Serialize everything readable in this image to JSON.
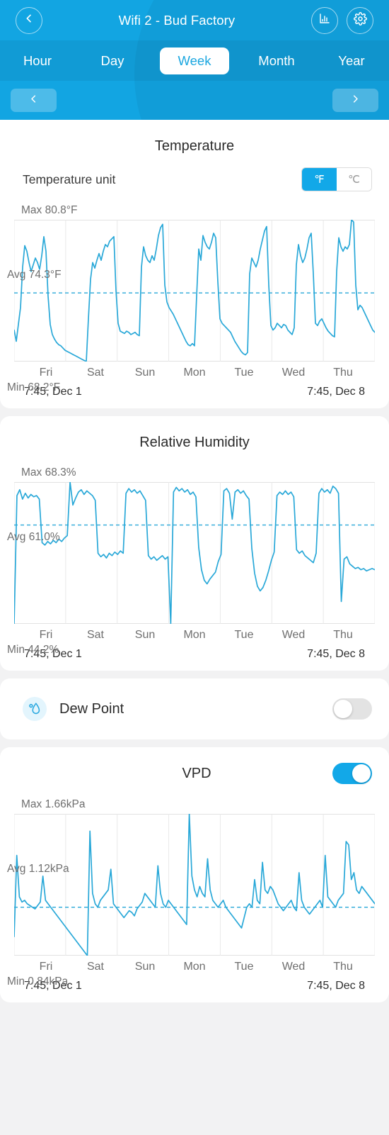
{
  "header": {
    "title": "Wifi 2 - Bud Factory",
    "back_icon": "chevron-left-icon",
    "stats_icon": "bar-chart-icon",
    "settings_icon": "gear-icon",
    "accent": "#12a5e2",
    "tabs": [
      {
        "label": "Hour",
        "active": false
      },
      {
        "label": "Day",
        "active": false
      },
      {
        "label": "Week",
        "active": true
      },
      {
        "label": "Month",
        "active": false
      },
      {
        "label": "Year",
        "active": false
      }
    ],
    "nav": {
      "prev_icon": "chevron-left-icon",
      "next_icon": "chevron-right-icon"
    }
  },
  "temperature": {
    "title": "Temperature",
    "unit_label": "Temperature unit",
    "unit_options": [
      {
        "label": "℉",
        "active": true
      },
      {
        "label": "℃",
        "active": false
      }
    ],
    "max_label": "Max 80.8°F",
    "avg_label": "Avg 74.3°F",
    "min_label": "Min 68.2°F",
    "range_start": "7:45,  Dec 1",
    "range_end": "7:45,  Dec 8"
  },
  "humidity": {
    "title": "Relative Humidity",
    "max_label": "Max 68.3%",
    "avg_label": "Avg 61.0%",
    "min_label": "Min 44.2%",
    "range_start": "7:45,  Dec 1",
    "range_end": "7:45,  Dec 8"
  },
  "dew_point": {
    "label": "Dew Point",
    "icon": "dew-drop-icon",
    "toggle_on": false
  },
  "vpd": {
    "title": "VPD",
    "toggle_on": true,
    "max_label": "Max 1.66kPa",
    "avg_label": "Avg 1.12kPa",
    "min_label": "Min 0.84kPa",
    "range_start": "7:45,  Dec 1",
    "range_end": "7:45,  Dec 8"
  },
  "x_axis_days": [
    "Fri",
    "Sat",
    "Sun",
    "Mon",
    "Tue",
    "Wed",
    "Thu"
  ],
  "chart_data": [
    {
      "id": "temperature",
      "type": "line",
      "title": "Temperature",
      "ylabel": "°F",
      "xlabel": "",
      "unit": "°F",
      "grid": true,
      "legend": "none",
      "tick_labels": [
        "Fri",
        "Sat",
        "Sun",
        "Mon",
        "Tue",
        "Wed",
        "Thu"
      ],
      "x_start": "7:45, Dec 1",
      "x_end": "7:45, Dec 8",
      "max": 80.8,
      "avg": 74.3,
      "min": 68.2,
      "ylim": [
        68.2,
        80.8
      ],
      "line_color": "#29a8d8",
      "avg_line_style": "dashed",
      "values": [
        71.0,
        70.0,
        71.5,
        73.0,
        76.6,
        78.5,
        78.0,
        77.0,
        76.2,
        76.8,
        77.4,
        77.0,
        76.4,
        77.6,
        79.3,
        78.0,
        74.0,
        71.5,
        70.6,
        70.2,
        69.9,
        69.7,
        69.6,
        69.4,
        69.2,
        69.1,
        69.0,
        68.9,
        68.8,
        68.7,
        68.6,
        68.5,
        68.4,
        68.3,
        68.2,
        72.0,
        75.5,
        77.0,
        76.5,
        77.2,
        77.8,
        77.2,
        78.0,
        78.6,
        78.4,
        78.9,
        79.1,
        79.3,
        74.5,
        71.6,
        70.9,
        70.8,
        70.7,
        70.9,
        70.8,
        70.6,
        70.7,
        70.8,
        70.6,
        70.5,
        76.6,
        78.4,
        77.6,
        77.2,
        77.0,
        77.6,
        77.2,
        78.2,
        79.4,
        80.1,
        80.4,
        75.0,
        73.5,
        73.0,
        72.7,
        72.4,
        72.0,
        71.6,
        71.2,
        70.8,
        70.4,
        70.0,
        69.7,
        69.6,
        69.8,
        69.6,
        74.0,
        78.2,
        77.2,
        79.4,
        78.8,
        78.4,
        78.2,
        78.8,
        79.6,
        79.2,
        75.3,
        72.0,
        71.6,
        71.4,
        71.2,
        71.0,
        70.8,
        70.4,
        70.0,
        69.7,
        69.4,
        69.1,
        68.9,
        68.8,
        69.0,
        76.0,
        77.4,
        77.0,
        76.6,
        77.2,
        78.2,
        79.0,
        79.8,
        80.2,
        75.0,
        71.4,
        71.0,
        71.2,
        71.6,
        71.4,
        71.2,
        71.5,
        71.4,
        71.0,
        70.8,
        70.6,
        71.2,
        76.8,
        78.6,
        77.6,
        77.0,
        77.4,
        78.2,
        79.2,
        79.6,
        76.0,
        71.6,
        71.4,
        71.8,
        72.0,
        71.6,
        71.2,
        70.9,
        70.7,
        70.5,
        70.4,
        76.2,
        79.2,
        78.4,
        78.0,
        78.4,
        78.2,
        78.6,
        80.8,
        80.6,
        75.0,
        72.8,
        73.2,
        73.0,
        72.6,
        72.2,
        71.8,
        71.4,
        71.0,
        70.8
      ]
    },
    {
      "id": "humidity",
      "type": "line",
      "title": "Relative Humidity",
      "ylabel": "%",
      "xlabel": "",
      "unit": "%",
      "grid": true,
      "legend": "none",
      "tick_labels": [
        "Fri",
        "Sat",
        "Sun",
        "Mon",
        "Tue",
        "Wed",
        "Thu"
      ],
      "x_start": "7:45, Dec 1",
      "x_end": "7:45, Dec 8",
      "max": 68.3,
      "avg": 61.0,
      "min": 44.2,
      "ylim": [
        44.2,
        68.3
      ],
      "line_color": "#29a8d8",
      "avg_line_style": "dashed",
      "values": [
        44.2,
        66.0,
        67.0,
        65.4,
        66.4,
        65.6,
        66.2,
        65.8,
        66.0,
        65.4,
        58.0,
        57.6,
        58.2,
        57.8,
        58.4,
        58.0,
        58.6,
        58.2,
        58.8,
        59.2,
        68.3,
        64.4,
        65.6,
        66.6,
        67.0,
        66.2,
        66.8,
        66.4,
        66.0,
        65.2,
        56.2,
        55.6,
        56.0,
        55.4,
        56.2,
        55.8,
        56.4,
        56.0,
        56.6,
        56.2,
        66.4,
        67.2,
        66.6,
        67.0,
        66.4,
        66.8,
        66.0,
        65.2,
        55.8,
        55.2,
        55.6,
        55.0,
        55.4,
        55.8,
        55.2,
        55.6,
        44.2,
        66.6,
        67.4,
        66.8,
        67.2,
        66.6,
        67.0,
        66.2,
        66.6,
        65.8,
        57.2,
        53.4,
        51.6,
        51.0,
        51.8,
        52.4,
        53.0,
        54.8,
        56.0,
        66.8,
        67.2,
        66.4,
        62.0,
        66.6,
        67.0,
        66.4,
        66.8,
        66.0,
        65.4,
        57.0,
        52.8,
        50.6,
        49.8,
        50.4,
        51.6,
        53.2,
        55.0,
        56.4,
        66.0,
        66.6,
        66.2,
        66.8,
        66.2,
        66.6,
        65.8,
        56.8,
        56.2,
        56.6,
        55.8,
        55.4,
        55.0,
        54.6,
        56.2,
        66.4,
        67.2,
        66.6,
        67.0,
        66.4,
        67.6,
        67.2,
        66.4,
        48.0,
        55.2,
        55.6,
        54.4,
        54.0,
        53.6,
        53.8,
        53.4,
        53.6,
        53.2,
        53.4,
        53.6,
        53.4
      ]
    },
    {
      "id": "vpd",
      "type": "line",
      "title": "VPD",
      "ylabel": "kPa",
      "xlabel": "",
      "unit": "kPa",
      "grid": true,
      "legend": "none",
      "tick_labels": [
        "Fri",
        "Sat",
        "Sun",
        "Mon",
        "Tue",
        "Wed",
        "Thu"
      ],
      "x_start": "7:45, Dec 1",
      "x_end": "7:45, Dec 8",
      "max": 1.66,
      "avg": 1.12,
      "min": 0.84,
      "ylim": [
        0.84,
        1.66
      ],
      "line_color": "#29a8d8",
      "avg_line_style": "dashed",
      "values": [
        0.95,
        1.42,
        1.18,
        1.15,
        1.16,
        1.14,
        1.13,
        1.12,
        1.11,
        1.13,
        1.15,
        1.3,
        1.16,
        1.14,
        1.12,
        1.1,
        1.08,
        1.06,
        1.04,
        1.02,
        1.0,
        0.98,
        0.96,
        0.94,
        0.92,
        0.9,
        0.88,
        0.86,
        0.84,
        1.56,
        1.2,
        1.14,
        1.12,
        1.16,
        1.18,
        1.2,
        1.22,
        1.34,
        1.14,
        1.12,
        1.1,
        1.08,
        1.06,
        1.08,
        1.1,
        1.09,
        1.07,
        1.11,
        1.13,
        1.15,
        1.2,
        1.18,
        1.16,
        1.14,
        1.12,
        1.36,
        1.2,
        1.14,
        1.12,
        1.16,
        1.14,
        1.12,
        1.1,
        1.08,
        1.06,
        1.04,
        1.02,
        1.66,
        1.3,
        1.22,
        1.18,
        1.24,
        1.2,
        1.18,
        1.4,
        1.22,
        1.16,
        1.14,
        1.12,
        1.14,
        1.16,
        1.12,
        1.1,
        1.08,
        1.06,
        1.04,
        1.02,
        1.0,
        1.06,
        1.12,
        1.14,
        1.12,
        1.28,
        1.16,
        1.14,
        1.38,
        1.22,
        1.2,
        1.24,
        1.22,
        1.18,
        1.14,
        1.12,
        1.1,
        1.12,
        1.14,
        1.16,
        1.12,
        1.1,
        1.32,
        1.16,
        1.12,
        1.1,
        1.08,
        1.1,
        1.12,
        1.14,
        1.16,
        1.12,
        1.42,
        1.18,
        1.16,
        1.14,
        1.12,
        1.16,
        1.18,
        1.2,
        1.5,
        1.48,
        1.28,
        1.32,
        1.22,
        1.2,
        1.24,
        1.22,
        1.2,
        1.18,
        1.16,
        1.14
      ]
    }
  ]
}
